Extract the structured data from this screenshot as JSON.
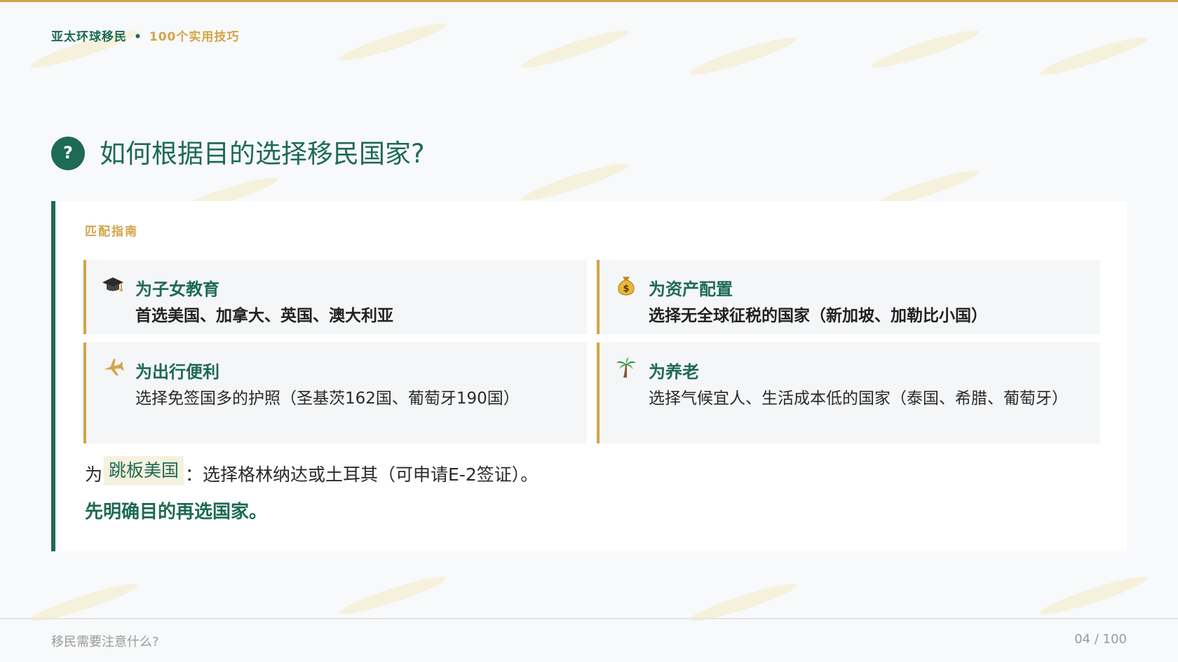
{
  "header": {
    "brand_name": "亚太环球移民",
    "separator": "•",
    "series_name": "100个实用技巧"
  },
  "question": {
    "icon": "question-icon",
    "icon_glyph": "?",
    "title": "如何根据目的选择移民国家?"
  },
  "card": {
    "label": "匹配指南",
    "items": [
      {
        "icon": "graduation-cap-icon",
        "heading": "为子女教育",
        "body": "首选美国、加拿大、英国、澳大利亚"
      },
      {
        "icon": "money-bag-icon",
        "heading": "为资产配置",
        "body": "选择无全球征税的国家（新加坡、加勒比小国）"
      },
      {
        "icon": "airplane-icon",
        "heading": "为出行便利",
        "body": "选择免签国多的护照（圣基茨162国、葡萄牙190国）"
      },
      {
        "icon": "palm-tree-icon",
        "heading": "为养老",
        "body": "选择气候宜人、生活成本低的国家（泰国、希腊、葡萄牙）"
      }
    ],
    "springboard": {
      "prefix": "为",
      "highlight": "跳板美国",
      "suffix": "：选择格林纳达或土耳其（可申请E-2签证）。"
    },
    "conclusion": "先明确目的再选国家。"
  },
  "footer": {
    "section_title": "移民需要注意什么?",
    "page_indicator": "04 / 100"
  },
  "colors": {
    "primary": "#1d6a55",
    "accent": "#d4a447",
    "background": "#f8f9fa"
  }
}
